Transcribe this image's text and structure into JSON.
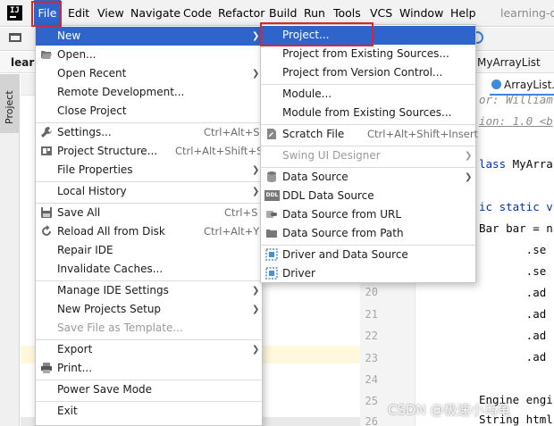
{
  "menubar": {
    "items": [
      "File",
      "Edit",
      "View",
      "Navigate",
      "Code",
      "Refactor",
      "Build",
      "Run",
      "Tools",
      "VCS",
      "Window",
      "Help"
    ],
    "window_title": "learning-de"
  },
  "breadcrumb": {
    "project": "learn",
    "file_tab": "MyArrayList",
    "file_tab2": "ArrayList.ja"
  },
  "side_tool": {
    "label": "Project"
  },
  "file_menu": {
    "items": [
      {
        "label": "New",
        "shortcut": "",
        "submenu": true,
        "icon": ""
      },
      {
        "label": "Open...",
        "shortcut": "",
        "submenu": false,
        "icon": "folder-open-icon"
      },
      {
        "label": "Open Recent",
        "shortcut": "",
        "submenu": true,
        "icon": ""
      },
      {
        "label": "Remote Development...",
        "shortcut": "",
        "submenu": false,
        "icon": ""
      },
      {
        "label": "Close Project",
        "shortcut": "",
        "submenu": false,
        "icon": ""
      },
      {
        "label": "Settings...",
        "shortcut": "Ctrl+Alt+S",
        "submenu": false,
        "icon": "wrench-icon"
      },
      {
        "label": "Project Structure...",
        "shortcut": "Ctrl+Alt+Shift+S",
        "submenu": false,
        "icon": "project-structure-icon"
      },
      {
        "label": "File Properties",
        "shortcut": "",
        "submenu": true,
        "icon": ""
      },
      {
        "label": "Local History",
        "shortcut": "",
        "submenu": true,
        "icon": ""
      },
      {
        "label": "Save All",
        "shortcut": "Ctrl+S",
        "submenu": false,
        "icon": "save-icon"
      },
      {
        "label": "Reload All from Disk",
        "shortcut": "Ctrl+Alt+Y",
        "submenu": false,
        "icon": "reload-icon"
      },
      {
        "label": "Repair IDE",
        "shortcut": "",
        "submenu": false,
        "icon": ""
      },
      {
        "label": "Invalidate Caches...",
        "shortcut": "",
        "submenu": false,
        "icon": ""
      },
      {
        "label": "Manage IDE Settings",
        "shortcut": "",
        "submenu": true,
        "icon": ""
      },
      {
        "label": "New Projects Setup",
        "shortcut": "",
        "submenu": true,
        "icon": ""
      },
      {
        "label": "Save File as Template...",
        "shortcut": "",
        "submenu": false,
        "icon": ""
      },
      {
        "label": "Export",
        "shortcut": "",
        "submenu": true,
        "icon": ""
      },
      {
        "label": "Print...",
        "shortcut": "",
        "submenu": false,
        "icon": "printer-icon"
      },
      {
        "label": "Power Save Mode",
        "shortcut": "",
        "submenu": false,
        "icon": ""
      },
      {
        "label": "Exit",
        "shortcut": "",
        "submenu": false,
        "icon": ""
      }
    ]
  },
  "new_menu": {
    "items": [
      {
        "label": "Project...",
        "shortcut": "",
        "submenu": false,
        "icon": ""
      },
      {
        "label": "Project from Existing Sources...",
        "shortcut": "",
        "submenu": false,
        "icon": ""
      },
      {
        "label": "Project from Version Control...",
        "shortcut": "",
        "submenu": false,
        "icon": ""
      },
      {
        "label": "Module...",
        "shortcut": "",
        "submenu": false,
        "icon": ""
      },
      {
        "label": "Module from Existing Sources...",
        "shortcut": "",
        "submenu": false,
        "icon": ""
      },
      {
        "label": "Scratch File",
        "shortcut": "Ctrl+Alt+Shift+Insert",
        "submenu": false,
        "icon": "scratch-file-icon"
      },
      {
        "label": "Swing UI Designer",
        "shortcut": "",
        "submenu": true,
        "icon": ""
      },
      {
        "label": "Data Source",
        "shortcut": "",
        "submenu": true,
        "icon": "database-icon"
      },
      {
        "label": "DDL Data Source",
        "shortcut": "",
        "submenu": false,
        "icon": "ddl-icon"
      },
      {
        "label": "Data Source from URL",
        "shortcut": "",
        "submenu": false,
        "icon": "url-datasource-icon"
      },
      {
        "label": "Data Source from Path",
        "shortcut": "",
        "submenu": false,
        "icon": "folder-datasource-icon"
      },
      {
        "label": "Driver and Data Source",
        "shortcut": "",
        "submenu": false,
        "icon": "driver-icon"
      },
      {
        "label": "Driver",
        "shortcut": "",
        "submenu": false,
        "icon": "driver-icon"
      }
    ]
  },
  "editor": {
    "line_numbers": [
      "20",
      "21",
      "22",
      "23",
      "24",
      "25",
      "26"
    ],
    "code_lines": [
      {
        "text": "or: William",
        "style": "doc"
      },
      {
        "text": "ion: 1.0 <b",
        "style": "doctag"
      },
      {
        "text": "lass MyArra",
        "style": "kwmix"
      },
      {
        "text": "ic static v",
        "style": "kw"
      },
      {
        "text": "Bar bar = n",
        "style": "plain"
      },
      {
        "text": "       .se",
        "style": "plain"
      },
      {
        "text": "       .se",
        "style": "plain"
      },
      {
        "text": "       .ad",
        "style": "plain"
      },
      {
        "text": "       .ad",
        "style": "plain"
      },
      {
        "text": "       .ad",
        "style": "plain"
      },
      {
        "text": "       .ad",
        "style": "plain"
      },
      {
        "text": "Engine engi",
        "style": "plain"
      },
      {
        "text": "String html",
        "style": "plain"
      }
    ]
  },
  "watermark": "CSDN @极速小乌龟"
}
